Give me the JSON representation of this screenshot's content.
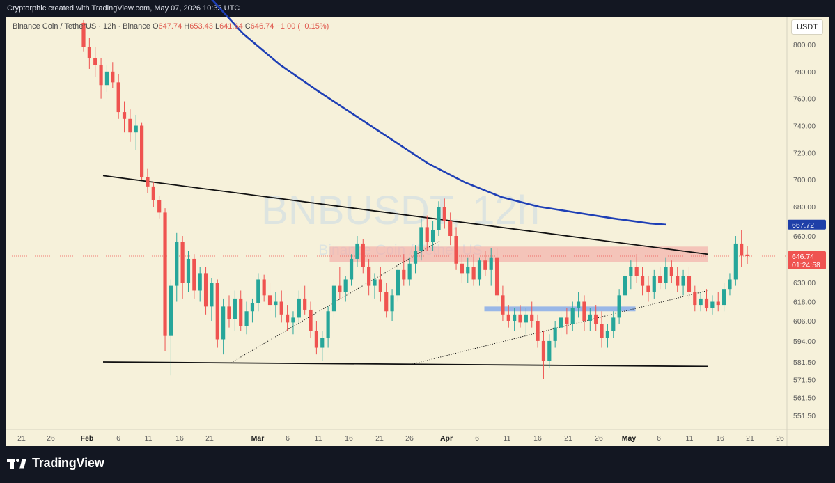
{
  "header": {
    "credit": "Cryptorphic created with TradingView.com, May 07, 2026 10:35 UTC"
  },
  "legend": {
    "symbol": "Binance Coin / TetherUS · 12h · Binance",
    "o_label": "O",
    "o_value": "647.74",
    "h_label": "H",
    "h_value": "653.43",
    "l_label": "L",
    "l_value": "641.64",
    "c_label": "C",
    "c_value": "646.74",
    "change": "−1.00 (−0.15%)"
  },
  "currency": "USDT",
  "brand": {
    "name": "TradingView"
  },
  "chart_data": {
    "type": "candlestick",
    "watermark_symbol": "BNBUSDT, 12h",
    "watermark_name": "Binance Coin / Tether US",
    "ylim": [
      545,
      816
    ],
    "y_ticks": [
      "800.00",
      "780.00",
      "760.00",
      "740.00",
      "720.00",
      "700.00",
      "680.00",
      "660.00",
      "630.00",
      "618.00",
      "606.00",
      "594.00",
      "581.50",
      "571.50",
      "561.50",
      "551.50"
    ],
    "x_ticks": [
      "21",
      "26",
      "Feb",
      "6",
      "11",
      "16",
      "21",
      "Mar",
      "6",
      "11",
      "16",
      "21",
      "26",
      "Apr",
      "6",
      "11",
      "16",
      "21",
      "26",
      "May",
      "6",
      "11",
      "16",
      "21",
      "26"
    ],
    "x_tick_bold": [
      "Feb",
      "Mar",
      "Apr",
      "May"
    ],
    "price_labels": [
      {
        "value": "667.72",
        "price": 667.72,
        "color": "#1e3fa8"
      },
      {
        "value": "646.74",
        "price": 646.74,
        "color": "#ef5350",
        "sub": "01:24:58"
      }
    ],
    "colors": {
      "up": "#26a69a",
      "down": "#ef5350",
      "ma": "#1e3fb5",
      "zone_red": "#f4a7a3",
      "zone_blue": "#8fb0e8"
    },
    "candles": [
      [
        816,
        818,
        795,
        798
      ],
      [
        798,
        805,
        782,
        790
      ],
      [
        790,
        798,
        776,
        785
      ],
      [
        785,
        790,
        760,
        770
      ],
      [
        770,
        785,
        765,
        780
      ],
      [
        780,
        787,
        768,
        772
      ],
      [
        772,
        778,
        745,
        750
      ],
      [
        750,
        758,
        735,
        745
      ],
      [
        745,
        752,
        728,
        735
      ],
      [
        735,
        748,
        722,
        740
      ],
      [
        740,
        742,
        700,
        702
      ],
      [
        702,
        708,
        690,
        695
      ],
      [
        695,
        698,
        680,
        685
      ],
      [
        685,
        688,
        672,
        676
      ],
      [
        676,
        679,
        588,
        597
      ],
      [
        597,
        632,
        574,
        628
      ],
      [
        628,
        662,
        618,
        656
      ],
      [
        656,
        660,
        620,
        630
      ],
      [
        630,
        650,
        624,
        645
      ],
      [
        645,
        648,
        620,
        625
      ],
      [
        625,
        640,
        618,
        636
      ],
      [
        636,
        640,
        610,
        615
      ],
      [
        615,
        633,
        606,
        630
      ],
      [
        630,
        632,
        590,
        595
      ],
      [
        595,
        620,
        586,
        615
      ],
      [
        615,
        622,
        602,
        607
      ],
      [
        607,
        625,
        600,
        620
      ],
      [
        620,
        625,
        600,
        603
      ],
      [
        603,
        618,
        598,
        612
      ],
      [
        612,
        620,
        605,
        617
      ],
      [
        617,
        636,
        612,
        632
      ],
      [
        632,
        635,
        618,
        622
      ],
      [
        622,
        630,
        612,
        616
      ],
      [
        616,
        624,
        608,
        618
      ],
      [
        618,
        625,
        605,
        610
      ],
      [
        610,
        616,
        600,
        605
      ],
      [
        605,
        612,
        598,
        608
      ],
      [
        608,
        625,
        604,
        620
      ],
      [
        620,
        628,
        610,
        613
      ],
      [
        613,
        618,
        596,
        600
      ],
      [
        600,
        606,
        586,
        590
      ],
      [
        590,
        600,
        582,
        596
      ],
      [
        596,
        615,
        590,
        612
      ],
      [
        612,
        632,
        608,
        628
      ],
      [
        628,
        640,
        620,
        624
      ],
      [
        624,
        634,
        618,
        632
      ],
      [
        632,
        648,
        628,
        645
      ],
      [
        645,
        660,
        640,
        655
      ],
      [
        655,
        658,
        636,
        640
      ],
      [
        640,
        645,
        622,
        628
      ],
      [
        628,
        636,
        620,
        632
      ],
      [
        632,
        640,
        618,
        624
      ],
      [
        624,
        630,
        608,
        612
      ],
      [
        612,
        626,
        606,
        622
      ],
      [
        622,
        642,
        618,
        638
      ],
      [
        638,
        648,
        628,
        632
      ],
      [
        632,
        646,
        628,
        642
      ],
      [
        642,
        654,
        636,
        650
      ],
      [
        650,
        672,
        644,
        666
      ],
      [
        666,
        674,
        650,
        656
      ],
      [
        656,
        670,
        650,
        664
      ],
      [
        664,
        684,
        660,
        680
      ],
      [
        680,
        686,
        665,
        670
      ],
      [
        670,
        676,
        654,
        660
      ],
      [
        660,
        666,
        638,
        642
      ],
      [
        642,
        648,
        630,
        636
      ],
      [
        636,
        646,
        630,
        640
      ],
      [
        640,
        648,
        628,
        632
      ],
      [
        632,
        646,
        628,
        644
      ],
      [
        644,
        650,
        634,
        638
      ],
      [
        638,
        652,
        628,
        646
      ],
      [
        646,
        652,
        618,
        622
      ],
      [
        622,
        628,
        606,
        610
      ],
      [
        610,
        616,
        602,
        606
      ],
      [
        606,
        614,
        600,
        610
      ],
      [
        610,
        616,
        602,
        605
      ],
      [
        605,
        614,
        598,
        610
      ],
      [
        610,
        618,
        602,
        606
      ],
      [
        606,
        610,
        590,
        594
      ],
      [
        594,
        600,
        572,
        582
      ],
      [
        582,
        598,
        578,
        594
      ],
      [
        594,
        606,
        590,
        602
      ],
      [
        602,
        612,
        596,
        608
      ],
      [
        608,
        614,
        598,
        604
      ],
      [
        604,
        618,
        600,
        614
      ],
      [
        614,
        624,
        608,
        618
      ],
      [
        618,
        622,
        600,
        606
      ],
      [
        606,
        614,
        600,
        610
      ],
      [
        610,
        616,
        600,
        604
      ],
      [
        604,
        612,
        590,
        596
      ],
      [
        596,
        604,
        590,
        600
      ],
      [
        600,
        612,
        596,
        608
      ],
      [
        608,
        626,
        604,
        622
      ],
      [
        622,
        638,
        618,
        634
      ],
      [
        634,
        644,
        626,
        640
      ],
      [
        640,
        648,
        630,
        634
      ],
      [
        634,
        640,
        622,
        628
      ],
      [
        628,
        634,
        618,
        624
      ],
      [
        624,
        638,
        620,
        634
      ],
      [
        634,
        640,
        626,
        630
      ],
      [
        630,
        646,
        626,
        640
      ],
      [
        640,
        644,
        630,
        634
      ],
      [
        634,
        640,
        624,
        628
      ],
      [
        628,
        638,
        622,
        634
      ],
      [
        634,
        640,
        620,
        624
      ],
      [
        624,
        628,
        612,
        616
      ],
      [
        616,
        624,
        612,
        620
      ],
      [
        620,
        626,
        612,
        614
      ],
      [
        614,
        622,
        610,
        618
      ],
      [
        618,
        624,
        612,
        616
      ],
      [
        616,
        630,
        612,
        626
      ],
      [
        626,
        636,
        622,
        632
      ],
      [
        632,
        660,
        628,
        655
      ],
      [
        655,
        664,
        640,
        647
      ],
      [
        647.74,
        653.43,
        641.64,
        646.74
      ]
    ],
    "ma_series": [
      [
        0,
        838
      ],
      [
        40,
        808
      ],
      [
        80,
        785
      ],
      [
        120,
        766
      ],
      [
        160,
        748
      ],
      [
        200,
        730
      ],
      [
        240,
        712
      ],
      [
        280,
        698
      ],
      [
        320,
        687
      ],
      [
        360,
        680
      ],
      [
        400,
        676
      ],
      [
        440,
        672
      ],
      [
        480,
        668.5
      ],
      [
        497,
        667.72
      ]
    ],
    "trendlines": [
      {
        "name": "upper-resistance",
        "points": [
          [
            0,
            703
          ],
          [
            520,
            648
          ]
        ],
        "style": "solid"
      },
      {
        "name": "lower-support",
        "points": [
          [
            0,
            581.5
          ],
          [
            520,
            579
          ]
        ],
        "style": "solid"
      },
      {
        "name": "rising-support-1",
        "points": [
          [
            110,
            581
          ],
          [
            290,
            657
          ]
        ],
        "style": "dotted"
      },
      {
        "name": "rising-support-2",
        "points": [
          [
            264,
            580
          ],
          [
            520,
            625
          ]
        ],
        "style": "dotted"
      }
    ],
    "zones": [
      {
        "name": "resistance-zone",
        "x": [
          195,
          520
        ],
        "y": [
          643,
          653
        ],
        "color": "#f4a7a3"
      },
      {
        "name": "support-zone",
        "x": [
          328,
          458
        ],
        "y": [
          612,
          615
        ],
        "color": "#8fb0e8"
      }
    ]
  }
}
